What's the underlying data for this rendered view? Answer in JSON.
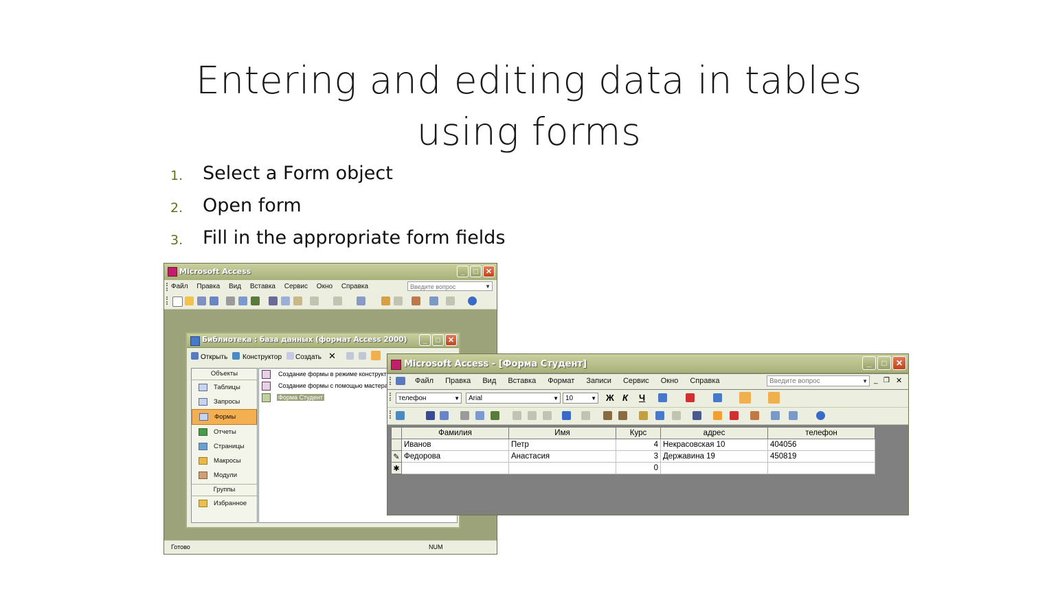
{
  "slide": {
    "title_line1": "Entering and editing data in tables",
    "title_line2": "using forms",
    "steps": [
      {
        "num": "1.",
        "text": "Select a Form object"
      },
      {
        "num": "2.",
        "text": "Open form"
      },
      {
        "num": "3.",
        "text": "Fill in the appropriate form fields"
      }
    ]
  },
  "access_window": {
    "title": "Microsoft Access",
    "menu": [
      "Файл",
      "Правка",
      "Вид",
      "Вставка",
      "Сервис",
      "Окно",
      "Справка"
    ],
    "ask_placeholder": "Введите вопрос",
    "status_left": "Готово",
    "status_num": "NUM"
  },
  "db_window": {
    "title": "Библиотека : база данных (формат Access 2000)",
    "tools": {
      "open": "Открыть",
      "design": "Конструктор",
      "create": "Создать"
    },
    "objects_header": "Объекты",
    "objects": [
      "Таблицы",
      "Запросы",
      "Формы",
      "Отчеты",
      "Страницы",
      "Макросы",
      "Модули"
    ],
    "groups_header": "Группы",
    "groups": [
      "Избранное"
    ],
    "list_items": [
      "Создание формы в режиме конструктора",
      "Создание формы с помощью мастера",
      "Форма Студент"
    ]
  },
  "form_window": {
    "title": "Microsoft Access - [Форма Студент]",
    "menu": [
      "Файл",
      "Правка",
      "Вид",
      "Вставка",
      "Формат",
      "Записи",
      "Сервис",
      "Окно",
      "Справка"
    ],
    "ask_placeholder": "Введите вопрос",
    "field_combo": "телефон",
    "font_combo": "Arial",
    "size_combo": "10",
    "format_buttons": {
      "bold": "Ж",
      "italic": "К",
      "underline": "Ч"
    },
    "columns": [
      "Фамилия",
      "Имя",
      "Курс",
      "адрес",
      "телефон"
    ],
    "rows": [
      {
        "marker": "",
        "surname": "Иванов",
        "name": "Петр",
        "course": "4",
        "address": "Некрасовская 10",
        "phone": "404056"
      },
      {
        "marker": "✎",
        "surname": "Федорова",
        "name": "Анастасия",
        "course": "3",
        "address": "Державина 19",
        "phone": "450819"
      },
      {
        "marker": "✱",
        "surname": "",
        "name": "",
        "course": "0",
        "address": "",
        "phone": ""
      }
    ]
  }
}
